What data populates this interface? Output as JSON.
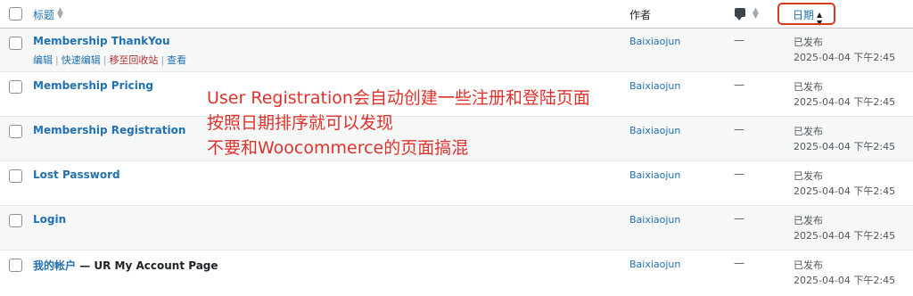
{
  "header": {
    "title_col": "标题",
    "author_col": "作者",
    "date_col": "日期"
  },
  "row_actions": {
    "edit": "编辑",
    "quick_edit": "快速编辑",
    "trash": "移至回收站",
    "view": "查看"
  },
  "rows": [
    {
      "title": "Membership ThankYou",
      "suffix": "",
      "author": "Baixiaojun",
      "comments": "—",
      "status": "已发布",
      "date": "2025-04-04 下午2:45"
    },
    {
      "title": "Membership Pricing",
      "suffix": "",
      "author": "Baixiaojun",
      "comments": "—",
      "status": "已发布",
      "date": "2025-04-04 下午2:45"
    },
    {
      "title": "Membership Registration",
      "suffix": "",
      "author": "Baixiaojun",
      "comments": "—",
      "status": "已发布",
      "date": "2025-04-04 下午2:45"
    },
    {
      "title": "Lost Password",
      "suffix": "",
      "author": "Baixiaojun",
      "comments": "—",
      "status": "已发布",
      "date": "2025-04-04 下午2:45"
    },
    {
      "title": "Login",
      "suffix": "",
      "author": "Baixiaojun",
      "comments": "—",
      "status": "已发布",
      "date": "2025-04-04 下午2:45"
    },
    {
      "title": "我的帐户",
      "suffix": " — UR My Account Page",
      "author": "Baixiaojun",
      "comments": "—",
      "status": "已发布",
      "date": "2025-04-04 下午2:45"
    }
  ],
  "annotation": {
    "line1": "User Registration会自动创建一些注册和登陆页面",
    "line2": "按照日期排序就可以发现",
    "line3": "不要和Woocommerce的页面搞混"
  },
  "colors": {
    "link": "#2271b1",
    "trash": "#b32d2e",
    "annotation": "#e0322c",
    "highlight_box": "#d63c1e"
  },
  "icons": {
    "sort": "sort-arrows-icon",
    "comment": "comment-bubble-icon",
    "date_sort": "sort-desc-icon"
  }
}
